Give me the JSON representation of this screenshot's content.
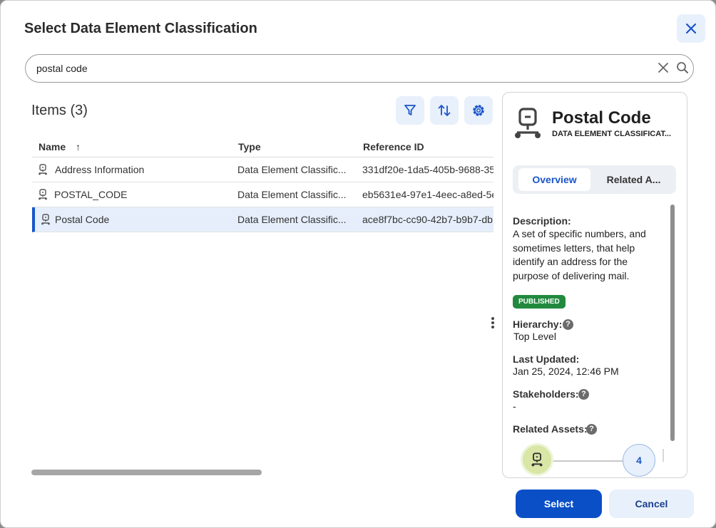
{
  "dialog": {
    "title": "Select Data Element Classification"
  },
  "search": {
    "value": "postal code"
  },
  "list": {
    "title": "Items (3)"
  },
  "table": {
    "columns": [
      "Name",
      "Type",
      "Reference ID"
    ],
    "sort_indicator": "↑",
    "rows": [
      {
        "name": "Address Information",
        "type": "Data Element Classific...",
        "ref": "331df20e-1da5-405b-9688-35"
      },
      {
        "name": "POSTAL_CODE",
        "type": "Data Element Classific...",
        "ref": "eb5631e4-97e1-4eec-a8ed-5e"
      },
      {
        "name": "Postal Code",
        "type": "Data Element Classific...",
        "ref": "ace8f7bc-cc90-42b7-b9b7-db"
      }
    ]
  },
  "detail": {
    "title": "Postal Code",
    "subtitle": "DATA ELEMENT CLASSIFICAT...",
    "tabs": [
      "Overview",
      "Related A..."
    ],
    "description_label": "Description:",
    "description": "A set of specific numbers, and sometimes letters, that help identify an address for the purpose of delivering mail.",
    "status": "PUBLISHED",
    "hierarchy_label": "Hierarchy:",
    "hierarchy": "Top Level",
    "updated_label": "Last Updated:",
    "updated": "Jan 25, 2024, 12:46 PM",
    "stakeholders_label": "Stakeholders:",
    "stakeholders": "-",
    "related_label": "Related Assets:",
    "related_count": "4"
  },
  "actions": {
    "select": "Select",
    "cancel": "Cancel"
  },
  "colors": {
    "primary": "#0b4fc7",
    "published": "#218a3e",
    "selected_row": "#e6eefb"
  }
}
